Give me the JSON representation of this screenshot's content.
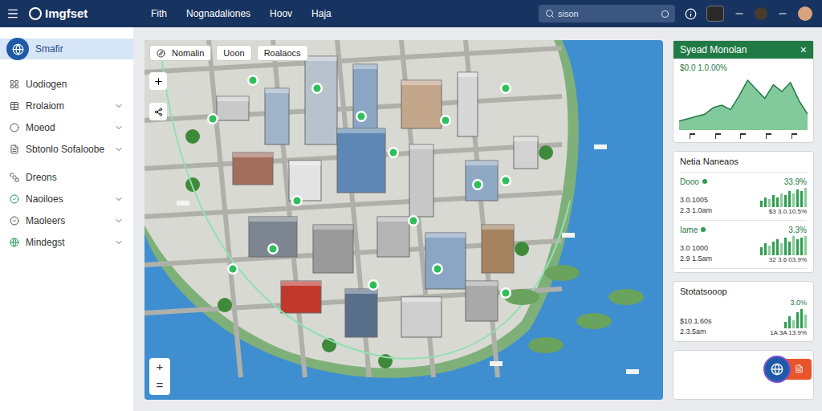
{
  "header": {
    "logo": "Imgfset",
    "menu": [
      "Fith",
      "Nognadaliones",
      "Hoov",
      "Haja"
    ],
    "search": {
      "placeholder": "sison"
    }
  },
  "sidebar": {
    "items": [
      {
        "label": "Smafir",
        "selected": true,
        "expandable": false
      },
      {
        "label": "Uodiogen",
        "selected": false,
        "expandable": false
      },
      {
        "label": "Rrolaiom",
        "selected": false,
        "expandable": true
      },
      {
        "label": "Moeod",
        "selected": false,
        "expandable": true
      },
      {
        "label": "Sbtonlo Sofaloobe",
        "selected": false,
        "expandable": true
      },
      {
        "label": "Dreons",
        "selected": false,
        "expandable": false
      },
      {
        "label": "Naoiloes",
        "selected": false,
        "expandable": true
      },
      {
        "label": "Maoleers",
        "selected": false,
        "expandable": true
      },
      {
        "label": "Mindegst",
        "selected": false,
        "expandable": true
      }
    ]
  },
  "map": {
    "toolbar": [
      "Nomalin",
      "Uoon",
      "Roalaocs"
    ],
    "zoom": [
      "+",
      "="
    ]
  },
  "cards": {
    "trend": {
      "title": "Syead Monolan",
      "close": "×",
      "value": "$0.0 1.0.00%",
      "chart": {
        "values": [
          8,
          10,
          12,
          14,
          20,
          22,
          18,
          30,
          44,
          36,
          28,
          40,
          34,
          42,
          26,
          14
        ]
      }
    },
    "stats": {
      "title": "Netia Naneaos",
      "rows": [
        {
          "name": "Dooo",
          "color": "#2e9e4f",
          "pct": "33.9%",
          "line1": "3.0.1005",
          "line2": "2.3 1.0am",
          "foot": "$3 3.0.10.5%",
          "bars": [
            3,
            5,
            4,
            6,
            5,
            7,
            6,
            8,
            7,
            9,
            8,
            10
          ]
        },
        {
          "name": "Iame",
          "color": "#2e9e4f",
          "pct": "3.3%",
          "line1": "3.0 1000",
          "line2": "2.9 1.5am",
          "foot": "32 3.6 03.9%",
          "bars": [
            4,
            6,
            5,
            7,
            8,
            6,
            9,
            7,
            10,
            8,
            9,
            10
          ]
        }
      ]
    },
    "status": {
      "title": "Stotatsooop",
      "pct": "3.0%",
      "line1": "$10.1.60s",
      "line2": "2.3.5am",
      "foot": "1A 3A 13.9%",
      "bars": [
        3,
        6,
        4,
        8,
        10,
        7
      ]
    }
  }
}
